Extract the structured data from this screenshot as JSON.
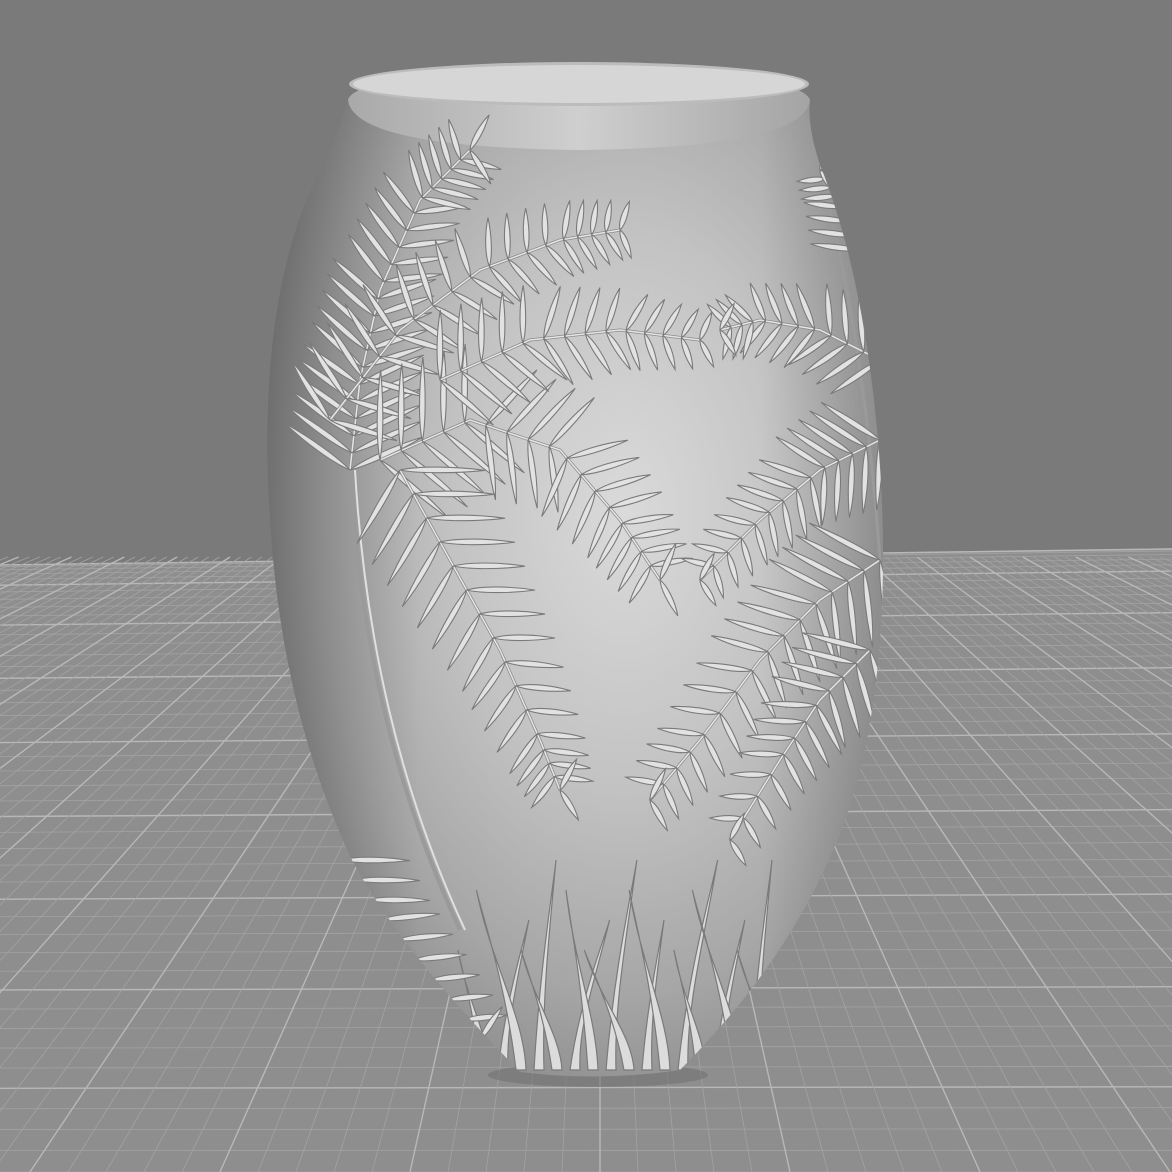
{
  "viewport": {
    "background_color": "#7a7a7a",
    "floor_color": "#8e8e8e",
    "grid_minor_color": "#a3a3a3",
    "grid_major_color": "#b8b8b8",
    "model_color": "#c4c4c4",
    "model_object": "vase-with-palm-leaf-relief"
  }
}
